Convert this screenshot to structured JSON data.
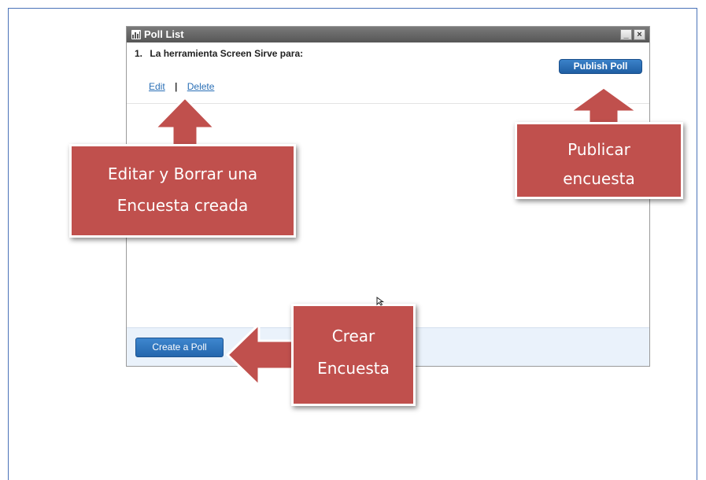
{
  "window": {
    "title": "Poll List",
    "minimize_glyph": "_",
    "close_glyph": "×"
  },
  "poll": {
    "number": "1.",
    "question": "La herramienta Screen Sirve para:",
    "edit_label": "Edit",
    "separator": "|",
    "delete_label": "Delete"
  },
  "buttons": {
    "publish_label": "Publish Poll",
    "create_label": "Create a Poll"
  },
  "callouts": {
    "edit_delete": {
      "line1": "Editar y Borrar una",
      "line2": "Encuesta creada"
    },
    "publish": {
      "line1": "Publicar",
      "line2": "encuesta"
    },
    "create": {
      "line1": "Crear",
      "line2": "Encuesta"
    }
  },
  "colors": {
    "callout": "#c0504d",
    "button_blue": "#2466ad",
    "titlebar": "#5f5f5f",
    "footer": "#eaf2fb"
  },
  "icons": [
    "poll-chart-icon",
    "minimize-icon",
    "close-icon",
    "arrow-up-icon",
    "arrow-left-icon",
    "mouse-cursor-icon"
  ]
}
